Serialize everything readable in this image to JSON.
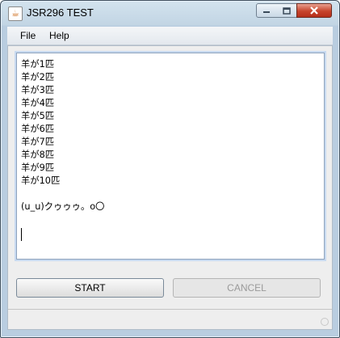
{
  "window": {
    "title": "JSR296 TEST",
    "icon": "java-cup-icon"
  },
  "title_controls": {
    "minimize": "minimize-icon",
    "maximize": "maximize-icon",
    "close": "close-icon"
  },
  "menubar": {
    "items": [
      {
        "label": "File"
      },
      {
        "label": "Help"
      }
    ]
  },
  "output": {
    "lines": [
      "羊が1匹",
      "羊が2匹",
      "羊が3匹",
      "羊が4匹",
      "羊が5匹",
      "羊が6匹",
      "羊が7匹",
      "羊が8匹",
      "羊が9匹",
      "羊が10匹",
      "",
      "(u_u)クゥゥゥ。o〇",
      ""
    ]
  },
  "buttons": {
    "start": "START",
    "cancel": "CANCEL"
  },
  "colors": {
    "title_gradient_top": "#d3e3ee",
    "close_button": "#c7442c",
    "disabled_text": "#9a9a9a"
  }
}
